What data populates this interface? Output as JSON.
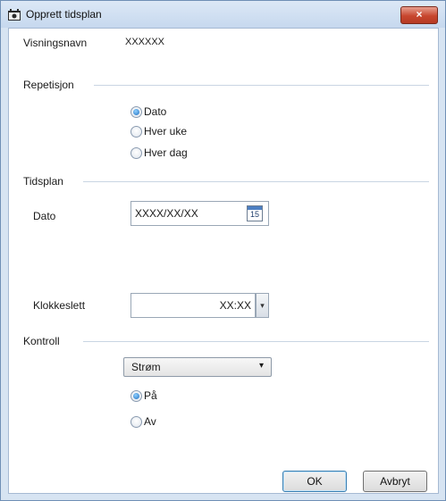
{
  "window": {
    "title": "Opprett tidsplan",
    "close_glyph": "×"
  },
  "display_name": {
    "label": "Visningsnavn",
    "value": "XXXXXX"
  },
  "repetition": {
    "group_label": "Repetisjon",
    "options": [
      {
        "label": "Dato",
        "checked": true
      },
      {
        "label": "Hver uke",
        "checked": false
      },
      {
        "label": "Hver dag",
        "checked": false
      }
    ]
  },
  "schedule": {
    "group_label": "Tidsplan",
    "date_label": "Dato",
    "date_value": "XXXX/XX/XX",
    "calendar_day": "15",
    "time_label": "Klokkeslett",
    "time_value": "XX:XX",
    "spin_glyph": "▾"
  },
  "control": {
    "group_label": "Kontroll",
    "select_value": "Strøm",
    "select_glyph": "▾",
    "options": [
      {
        "label": "På",
        "checked": true
      },
      {
        "label": "Av",
        "checked": false
      }
    ]
  },
  "buttons": {
    "ok": "OK",
    "cancel": "Avbryt"
  }
}
